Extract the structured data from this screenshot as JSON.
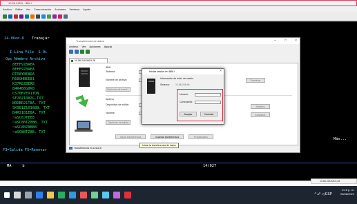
{
  "emulator": {
    "title": "10.56.245.5 - IBM i",
    "menu": [
      "Archivo",
      "Editar",
      "Ver",
      "Comunicación",
      "Acciones",
      "Ventana",
      "Ayuda"
    ]
  },
  "terminal": {
    "menu_num": "24-06ed-8",
    "menu_title": "Trabajar",
    "list_header": "I-Lina File  S-Oi",
    "col_header": "Opc Nombre Archivo",
    "files": [
      "8EEF9Z8AEA",
      "8EEF9Z8AEA",
      "RTR8YBE8DA",
      "R68OHBEE81",
      "K37R8Z8ER8",
      "B4R4B8G8K8",
      "CS70B7E91TDN",
      "SF2021082G.TXT",
      "BRDBR21T8A. TXT",
      "SK9D1Z1016BB. TXT",
      "B4R31B1E8A. TXT",
      "~aSC8JTEE8",
      "~aSC8BTZ8BB. TXT",
      "~aSC8BZ8BB8",
      "~aSC8BTZ8B. TXT"
    ],
    "more": "Más...",
    "fkeys": "F3=Salida F5=Renovar",
    "bottom_left": "MA     b",
    "position": "14/027"
  },
  "transfer_window": {
    "title": "Transferencia de datos",
    "menu": [
      "Archivo",
      "Ver",
      "Acciones",
      "Ayuda"
    ],
    "tab": "10.56.245.5/8.5.28",
    "ibm_i_label": "IBM i",
    "sistema_label": "Sistema:",
    "nombre_archivo_label": "Nombre de archivo:",
    "detalles_label": "Opciones de transf...",
    "archivo_label": "Archivo",
    "dispositivo_label": "Dispositivo de salida:",
    "nombre_label": "Nombre:",
    "detalles2_label": "Opciones de salida",
    "btn_examinar_1": "Examinar",
    "btn_examinar_2": "Examinar",
    "btn_detalles": "Detalles",
    "btn_iniciar": "Iniciar transferencia",
    "btn_guardar": "Guardar transferencia",
    "btn_propiedades": "Propiedades",
    "status": "Transferencia en Linea 5",
    "tooltip": "Iniciar la transferencia de datos"
  },
  "signon_dialog": {
    "title": "Iniciar sesión en IBM i",
    "info_title": "Información de inicio de sesión",
    "sistema_label": "Sistema:",
    "sistema_value": "10.56.245.5b",
    "usuario_label": "Usuario:",
    "contrasena_label": "Contraseña:",
    "aceptar": "Aceptar",
    "cancelar": "Cancelar"
  },
  "notify": {
    "text": "10.56.245.5/8.5.28"
  },
  "tray": {
    "time": "2:15 p. m.",
    "date": "25/08/2021",
    "lang": "ESP"
  }
}
